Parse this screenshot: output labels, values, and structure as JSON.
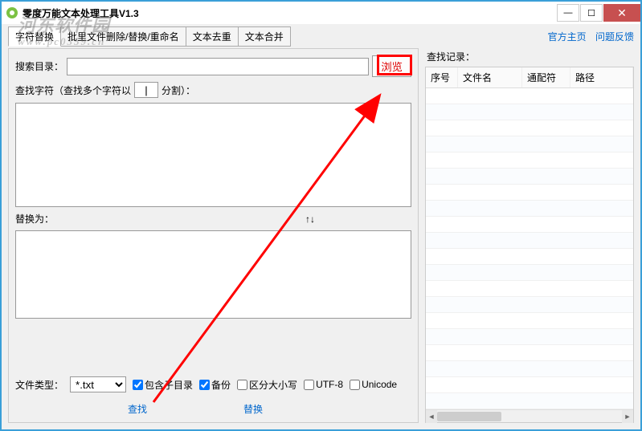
{
  "window": {
    "title": "零度万能文本处理工具V1.3"
  },
  "watermark": {
    "main": "河东软件园",
    "sub": "www.pc0359.cn"
  },
  "tabs": [
    "字符替换",
    "批里文件删除/替换/重命名",
    "文本去重",
    "文本合并"
  ],
  "links": {
    "home": "官方主页",
    "feedback": "问题反馈"
  },
  "left": {
    "searchDirLabel": "搜索目录：",
    "browseBtn": "浏览",
    "findCharLabelPre": "查找字符（查找多个字符以",
    "sepValue": "|",
    "findCharLabelPost": "分割）：",
    "replaceLabel": "替换为：",
    "arrows": "↑↓",
    "fileTypeLabel": "文件类型：",
    "fileTypeValue": "*.txt",
    "cbIncludeSub": "包含子目录",
    "cbBackup": "备份",
    "cbCase": "区分大小写",
    "cbUTF8": "UTF-8",
    "cbUnicode": "Unicode",
    "findAction": "查找",
    "replaceAction": "替换"
  },
  "right": {
    "title": "查找记录：",
    "cols": {
      "idx": "序号",
      "name": "文件名",
      "wildcard": "通配符",
      "path": "路径"
    }
  }
}
